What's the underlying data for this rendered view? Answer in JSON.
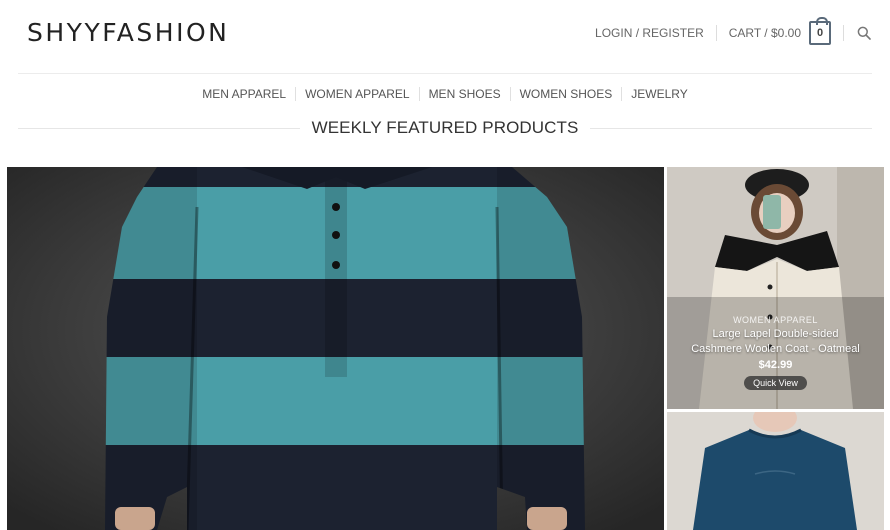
{
  "brand": {
    "logo_text": "SHYYFASHION"
  },
  "header": {
    "login_label": "LOGIN / REGISTER",
    "cart_label": "CART / $0.00",
    "cart_count": "0",
    "search_icon": "search-icon"
  },
  "nav": {
    "items": [
      {
        "label": "MEN APPAREL"
      },
      {
        "label": "WOMEN APPAREL"
      },
      {
        "label": "MEN SHOES"
      },
      {
        "label": "WOMEN SHOES"
      },
      {
        "label": "JEWELRY"
      }
    ]
  },
  "section": {
    "title": "WEEKLY FEATURED PRODUCTS"
  },
  "products": [
    {
      "image": "striped-polo-shirt-teal-black"
    },
    {
      "image": "woman-cream-cashmere-coat",
      "category": "WOMEN APPAREL",
      "name_line1": "Large Lapel Double-sided",
      "name_line2": "Cashmere Woolen Coat - Oatmeal",
      "price": "$42.99",
      "quick_view_label": "Quick View"
    },
    {
      "image": "navy-long-sleeve-tshirt"
    }
  ],
  "colors": {
    "teal_stripe": "#4a9ea7",
    "dark_stripe": "#1c2230",
    "navy_shirt": "#1d4a6b",
    "coat_cream": "#ece6da"
  }
}
